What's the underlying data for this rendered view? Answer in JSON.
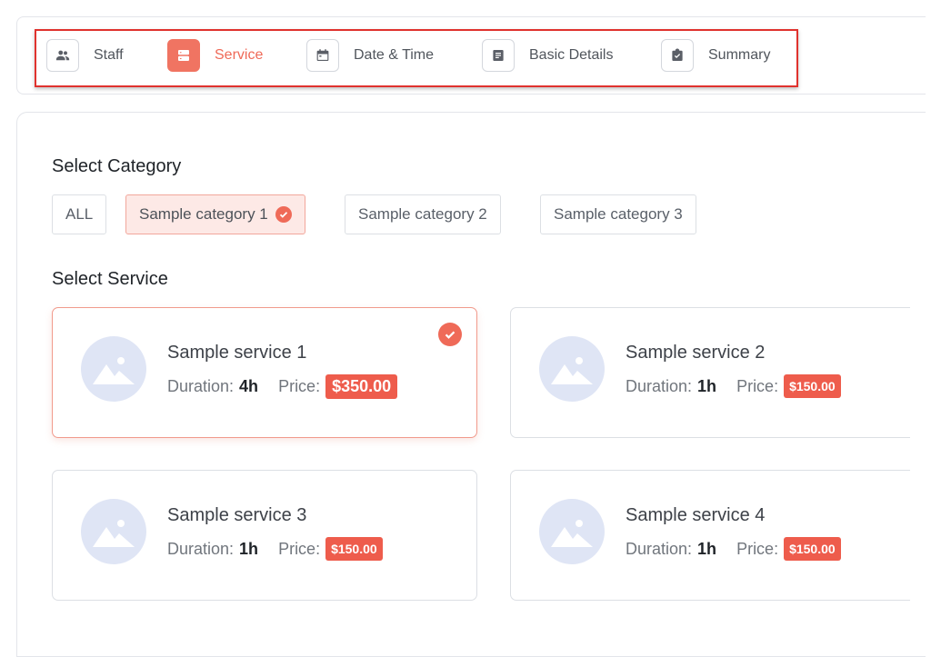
{
  "steps": [
    {
      "label": "Staff",
      "icon": "people-icon"
    },
    {
      "label": "Service",
      "icon": "server-icon",
      "active": true
    },
    {
      "label": "Date & Time",
      "icon": "calendar-icon"
    },
    {
      "label": "Basic Details",
      "icon": "document-icon"
    },
    {
      "label": "Summary",
      "icon": "clipboard-check-icon"
    }
  ],
  "category": {
    "title": "Select Category",
    "items": [
      {
        "label": "ALL"
      },
      {
        "label": "Sample category 1",
        "selected": true
      },
      {
        "label": "Sample category 2"
      },
      {
        "label": "Sample category 3"
      }
    ]
  },
  "service": {
    "title": "Select Service",
    "duration_label": "Duration:",
    "price_label": "Price:",
    "items": [
      {
        "name": "Sample service 1",
        "duration": "4h",
        "price": "$350.00",
        "selected": true
      },
      {
        "name": "Sample service 2",
        "duration": "1h",
        "price": "$150.00"
      },
      {
        "name": "Sample service 3",
        "duration": "1h",
        "price": "$150.00"
      },
      {
        "name": "Sample service 4",
        "duration": "1h",
        "price": "$150.00"
      }
    ]
  },
  "colors": {
    "accent": "#ef6a58",
    "price_badge": "#ee5c4c",
    "highlight_outline": "#e0322e",
    "thumb_bg": "#dfe5f5"
  }
}
